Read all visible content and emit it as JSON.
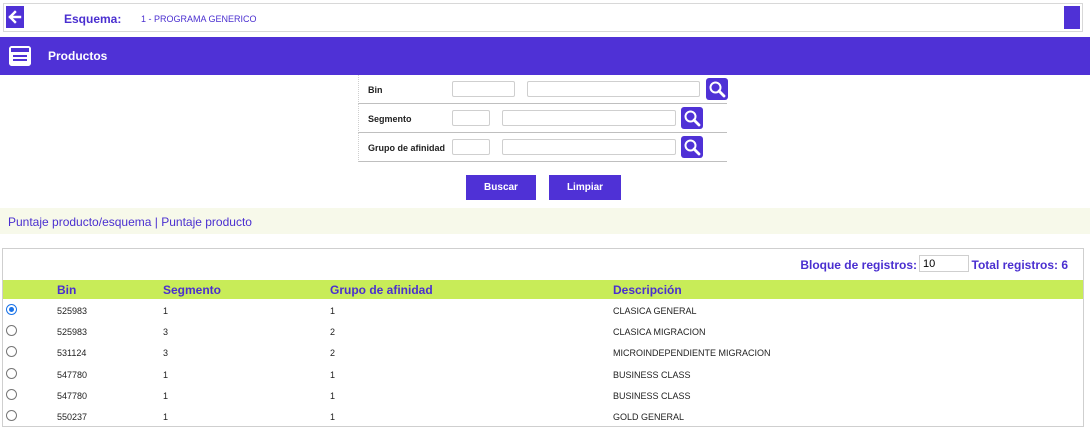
{
  "topbar": {
    "schema_label": "Esquema:",
    "schema_value": "1 -   PROGRAMA GENERICO"
  },
  "header": {
    "title": "Productos"
  },
  "filters": [
    {
      "label": "Bin",
      "code": "",
      "description": ""
    },
    {
      "label": "Segmento",
      "code": "",
      "description": ""
    },
    {
      "label": "Grupo de afinidad",
      "code": "",
      "description": ""
    }
  ],
  "actions": {
    "search_label": "Buscar",
    "clear_label": "Limpiar"
  },
  "breadcrumb": "Puntaje producto/esquema | Puntaje producto",
  "pager": {
    "block_label": "Bloque de registros:",
    "block_value": "10",
    "total_label": "Total registros: 6"
  },
  "table": {
    "columns": [
      "Bin",
      "Segmento",
      "Grupo de afinidad",
      "Descripción"
    ],
    "rows": [
      {
        "bin": "525983",
        "segmento": "1",
        "grupo": "1",
        "descripcion": "CLASICA GENERAL",
        "selected": true
      },
      {
        "bin": "525983",
        "segmento": "3",
        "grupo": "2",
        "descripcion": "CLASICA MIGRACION",
        "selected": false
      },
      {
        "bin": "531124",
        "segmento": "3",
        "grupo": "2",
        "descripcion": "MICROINDEPENDIENTE MIGRACION",
        "selected": false
      },
      {
        "bin": "547780",
        "segmento": "1",
        "grupo": "1",
        "descripcion": "BUSINESS CLASS",
        "selected": false
      },
      {
        "bin": "547780",
        "segmento": "1",
        "grupo": "1",
        "descripcion": "BUSINESS CLASS",
        "selected": false
      },
      {
        "bin": "550237",
        "segmento": "1",
        "grupo": "1",
        "descripcion": "GOLD GENERAL",
        "selected": false
      }
    ]
  },
  "colors": {
    "accent": "#4f31d6",
    "header_row": "#c8ec58",
    "link_bar": "#f7f9ea"
  },
  "icons": {
    "back": "arrow-left-icon",
    "header": "window-icon",
    "search": "magnifier-icon"
  }
}
